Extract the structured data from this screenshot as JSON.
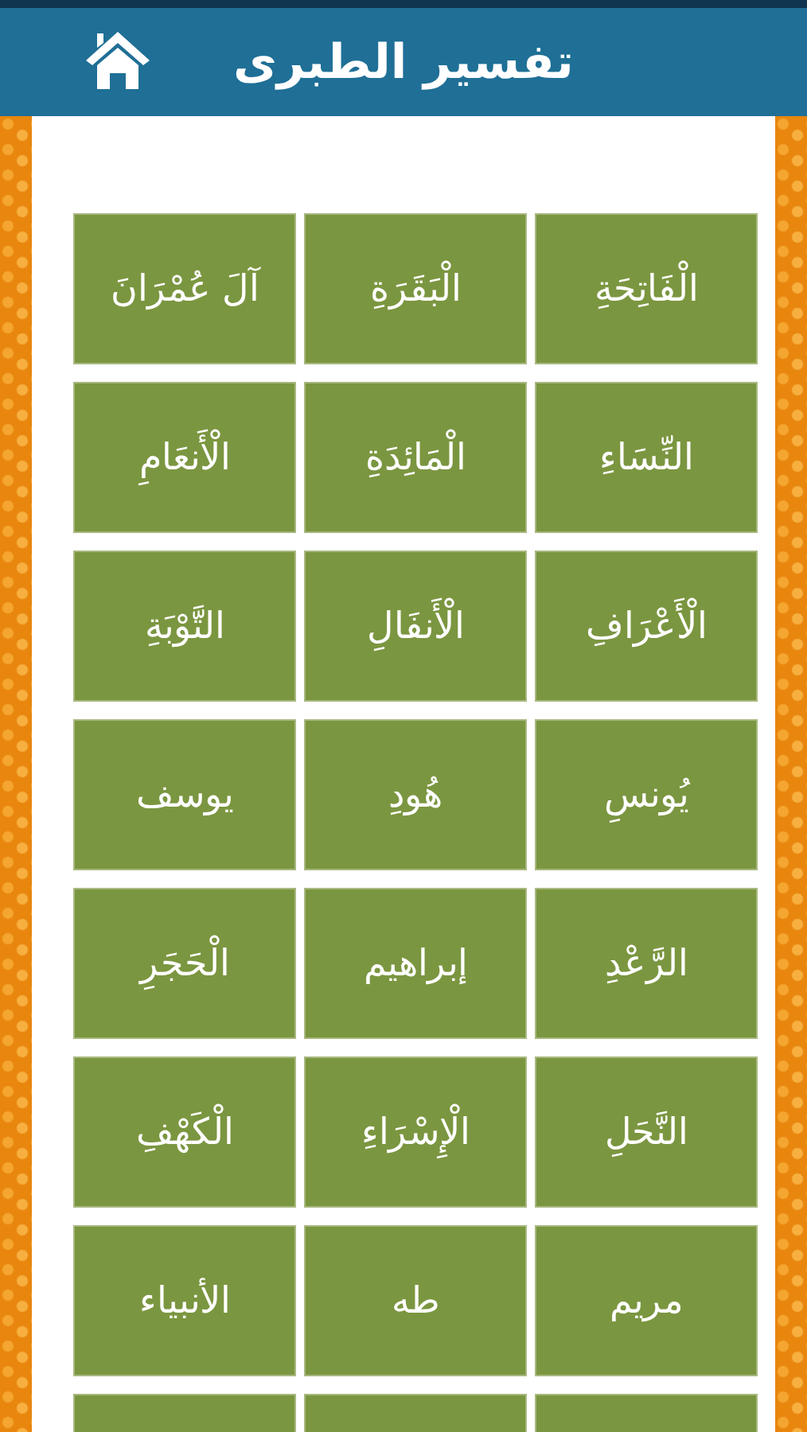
{
  "header": {
    "title": "تفسير الطبرى"
  },
  "tiles": [
    {
      "kind": "tile",
      "label": "الْفَاتِحَةِ"
    },
    {
      "kind": "tile",
      "label": "الْبَقَرَةِ"
    },
    {
      "kind": "tile",
      "label": "آلَ عُمْرَانَ"
    },
    {
      "kind": "tile",
      "label": "النِّسَاءِ"
    },
    {
      "kind": "tile",
      "label": "الْمَائِدَةِ"
    },
    {
      "kind": "tile",
      "label": "الْأَنعَامِ"
    },
    {
      "kind": "tile",
      "label": "الْأَعْرَافِ"
    },
    {
      "kind": "tile",
      "label": "الْأَنفَالِ"
    },
    {
      "kind": "tile",
      "label": "التَّوْبَةِ"
    },
    {
      "kind": "tile",
      "label": "يُونسِ"
    },
    {
      "kind": "tile",
      "label": "هُودِ"
    },
    {
      "kind": "tile",
      "label": "يوسف"
    },
    {
      "kind": "tile",
      "label": "الرَّعْدِ"
    },
    {
      "kind": "tile",
      "label": "إبراهيم"
    },
    {
      "kind": "tile",
      "label": "الْحَجَرِ"
    },
    {
      "kind": "tile",
      "label": "النَّحَلِ"
    },
    {
      "kind": "tile",
      "label": "الْإِسْرَاءِ"
    },
    {
      "kind": "tile",
      "label": "الْكَهْفِ"
    },
    {
      "kind": "tile",
      "label": "مريم"
    },
    {
      "kind": "tile",
      "label": "طه"
    },
    {
      "kind": "tile",
      "label": "الأنبياء"
    },
    {
      "kind": "partial"
    },
    {
      "kind": "partial"
    },
    {
      "kind": "partial"
    }
  ]
}
